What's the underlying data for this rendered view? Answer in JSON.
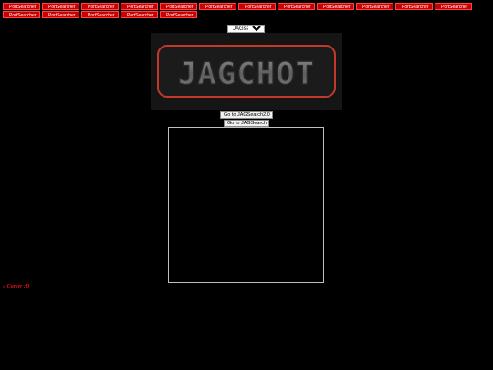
{
  "nav_buttons": {
    "row1": [
      "PortSearcher",
      "PortSearcher",
      "PortSearcher",
      "PortSearcher",
      "PortSearcher",
      "PortSearcher",
      "PortSearcher",
      "PortSearcher",
      "PortSearcher",
      "PortSearcher",
      "PortSearcher",
      "PortSearcher"
    ],
    "row2": [
      "PortSearcher",
      "PortSearcher",
      "PortSearcher",
      "PortSearcher",
      "PortSearcher"
    ]
  },
  "search_select": {
    "selected": "JAGsearch",
    "options": [
      "JAGsearch"
    ]
  },
  "logo": {
    "text": "JAGCHOT"
  },
  "goto_buttons": {
    "jagsearch2": "Go to JAGSearch2.0",
    "jagsearch": "Go to JAGSearch"
  },
  "footer": {
    "text": "» Curser :D"
  },
  "colors": {
    "background": "#000000",
    "button_red": "#cc0000",
    "logo_glow": "#c0392b"
  }
}
